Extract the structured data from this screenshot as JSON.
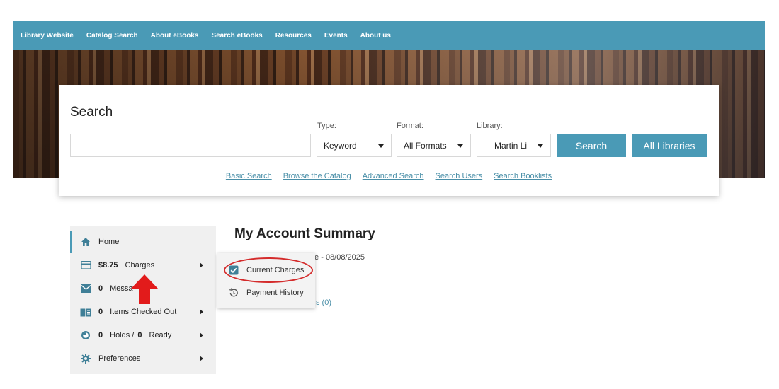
{
  "topnav": {
    "links": [
      "Library Website",
      "Catalog Search",
      "About eBooks",
      "Search eBooks",
      "Resources",
      "Events",
      "About us"
    ]
  },
  "search": {
    "title": "Search",
    "input_value": "",
    "type_label": "Type:",
    "type_value": "Keyword",
    "format_label": "Format:",
    "format_value": "All Formats",
    "library_label": "Library:",
    "library_value": "Martin Li",
    "search_button": "Search",
    "all_libraries_button": "All Libraries",
    "links": [
      "Basic Search",
      "Browse the Catalog",
      "Advanced Search",
      "Search Users",
      "Search Booklists"
    ]
  },
  "sidebar": {
    "home": "Home",
    "charges_amount": "$8.75",
    "charges_label": "Charges",
    "messages_count": "0",
    "messages_label": "Messa",
    "checked_out_count": "0",
    "checked_out_label": "Items Checked Out",
    "holds_count": "0",
    "holds_label": "Holds /",
    "ready_count": "0",
    "ready_label": "Ready",
    "preferences": "Preferences"
  },
  "flyout": {
    "current_charges": "Current Charges",
    "payment_history": "Payment History"
  },
  "main": {
    "title": "My Account Summary",
    "line1": "te - 08/08/2025",
    "link_partial": "s (0)"
  },
  "colors": {
    "brand": "#4a9ab6",
    "highlight": "#d42b2b",
    "sidebar_bg": "#f0f0f0"
  },
  "icons": [
    "home-icon",
    "credit-card-icon",
    "envelope-icon",
    "book-icon",
    "clock-icon",
    "gear-icon",
    "checkbox-icon",
    "history-icon",
    "caret-down-icon",
    "chevron-right-icon"
  ]
}
